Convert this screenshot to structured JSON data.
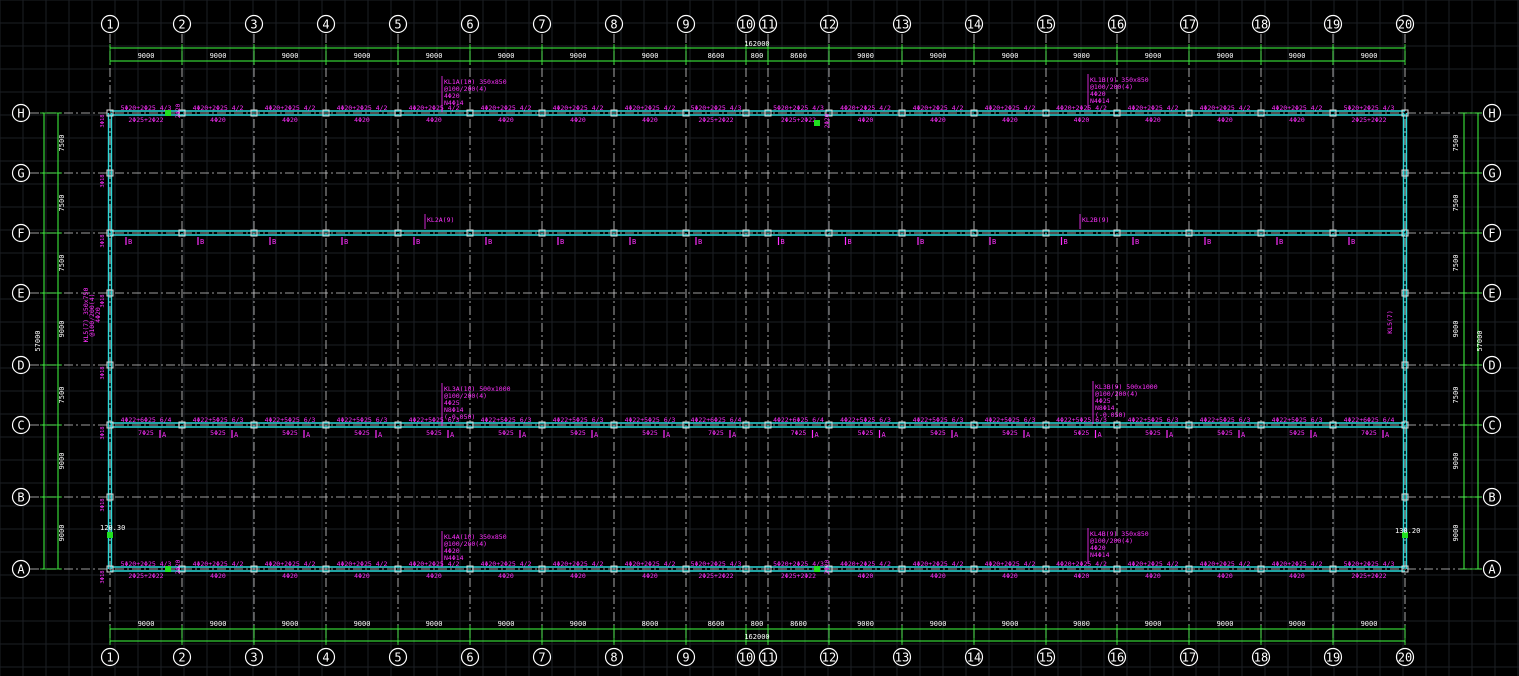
{
  "colors": {
    "background": "#000000",
    "grid": "#1c1f24",
    "axis_line": "#d0d0d0",
    "bubble": "#ffffff",
    "dimension": "#40ff40",
    "beam": "#2ad8d8",
    "annotation": "#ff30ff",
    "column": "#d8d8d8"
  },
  "column_axes": [
    {
      "label": "1"
    },
    {
      "label": "2"
    },
    {
      "label": "3"
    },
    {
      "label": "4"
    },
    {
      "label": "5"
    },
    {
      "label": "6"
    },
    {
      "label": "7"
    },
    {
      "label": "8"
    },
    {
      "label": "9"
    },
    {
      "label": "10"
    },
    {
      "label": "11"
    },
    {
      "label": "12"
    },
    {
      "label": "13"
    },
    {
      "label": "14"
    },
    {
      "label": "15"
    },
    {
      "label": "16"
    },
    {
      "label": "17"
    },
    {
      "label": "18"
    },
    {
      "label": "19"
    },
    {
      "label": "20"
    }
  ],
  "row_axes": [
    {
      "label": "H"
    },
    {
      "label": "G"
    },
    {
      "label": "F"
    },
    {
      "label": "E"
    },
    {
      "label": "D"
    },
    {
      "label": "C"
    },
    {
      "label": "B"
    },
    {
      "label": "A"
    }
  ],
  "dimensions": {
    "total_horizontal": "162000",
    "bays_horizontal": [
      "9000",
      "9000",
      "9000",
      "9000",
      "9000",
      "9000",
      "9000",
      "9000",
      "8600",
      "800",
      "8600",
      "9000",
      "9000",
      "9000",
      "9000",
      "9000",
      "9000",
      "9000",
      "9000"
    ],
    "bays_horizontal_bottom": [
      "9000",
      "9000",
      "9000",
      "9000",
      "9000",
      "9000",
      "9000",
      "8000",
      "8600",
      "800",
      "8600",
      "9000",
      "9000",
      "9000",
      "9000",
      "9000",
      "9000",
      "9000",
      "9000"
    ],
    "total_vertical": "57000",
    "bays_vertical": [
      "7500",
      "7500",
      "7500",
      "9000",
      "7500",
      "9000",
      "9000"
    ]
  },
  "beam_labels": {
    "top_left_callout": [
      "KL1A(10) 350x850",
      "@100/200(4)",
      "4Φ20",
      "N4Φ14"
    ],
    "top_right_callout": [
      "KL1B(9) 350x850",
      "@100/200(4)",
      "4Φ20",
      "N4Φ14"
    ],
    "f_left_callout": "KL2A(9)",
    "f_right_callout": "KL2B(9)",
    "c_left_callout": [
      "KL3A(10) 500x1000",
      "@100/200(4)",
      "4Φ25",
      "N8Φ14",
      "(-0.050)"
    ],
    "c_right_callout": [
      "KL3B(9) 500x1000",
      "@100/200(4)",
      "4Φ25",
      "N8Φ14",
      "(-0.050)"
    ],
    "a_left_callout": [
      "KL4A(10) 350x850",
      "@100/200(4)",
      "4Φ20",
      "N4Φ14"
    ],
    "a_right_callout": [
      "KL4B(9) 350x850",
      "@100/200(4)",
      "4Φ20",
      "N4Φ14"
    ],
    "h_top_span": [
      "5Φ20+2Φ25 4/3",
      "4Φ20+2Φ25 4/2",
      "4Φ20+2Φ25 4/2",
      "4Φ20+2Φ25 4/2",
      "4Φ20+2Φ25 4/2",
      "4Φ20+2Φ25 4/2",
      "4Φ20+2Φ25 4/2",
      "4Φ20+2Φ25 4/2",
      "5Φ20+2Φ25 4/3",
      "",
      "5Φ20+2Φ25 4/3",
      "4Φ20+2Φ25 4/2",
      "4Φ20+2Φ25 4/2",
      "4Φ20+2Φ25 4/2",
      "4Φ20+2Φ25 4/2",
      "4Φ20+2Φ25 4/2",
      "4Φ20+2Φ25 4/2",
      "4Φ20+2Φ25 4/2",
      "5Φ20+2Φ25 4/3"
    ],
    "h_bottom_span": [
      "2Φ25+2Φ22",
      "4Φ20",
      "4Φ20",
      "4Φ20",
      "4Φ20",
      "4Φ20",
      "4Φ20",
      "4Φ20",
      "2Φ25+2Φ22",
      "",
      "2Φ25+2Φ22",
      "4Φ20",
      "4Φ20",
      "4Φ20",
      "4Φ20",
      "4Φ20",
      "4Φ20",
      "4Φ20",
      "2Φ25+2Φ22"
    ],
    "c_top_span": [
      "4Φ22+6Φ25 6/4",
      "4Φ22+5Φ25 6/3",
      "4Φ22+5Φ25 6/3",
      "4Φ22+5Φ25 6/3",
      "4Φ22+5Φ25 6/3",
      "4Φ22+5Φ25 6/3",
      "4Φ22+5Φ25 6/3",
      "4Φ22+5Φ25 6/3",
      "4Φ22+6Φ25 6/4",
      "",
      "4Φ22+6Φ25 6/4",
      "4Φ22+5Φ25 6/3",
      "4Φ22+5Φ25 6/3",
      "4Φ22+5Φ25 6/3",
      "4Φ22+5Φ25 6/3",
      "4Φ22+5Φ25 6/3",
      "4Φ22+5Φ25 6/3",
      "4Φ22+5Φ25 6/3",
      "4Φ22+6Φ25 6/4"
    ],
    "c_bottom_span": [
      "7Φ25",
      "5Φ25",
      "5Φ25",
      "5Φ25",
      "5Φ25",
      "5Φ25",
      "5Φ25",
      "5Φ25",
      "7Φ25",
      "",
      "7Φ25",
      "5Φ25",
      "5Φ25",
      "5Φ25",
      "5Φ25",
      "5Φ25",
      "5Φ25",
      "5Φ25",
      "7Φ25"
    ],
    "a_top_span": [
      "5Φ20+2Φ25 4/3",
      "4Φ20+2Φ25 4/2",
      "4Φ20+2Φ25 4/2",
      "4Φ20+2Φ25 4/2",
      "4Φ20+2Φ25 4/2",
      "4Φ20+2Φ25 4/2",
      "4Φ20+2Φ25 4/2",
      "4Φ20+2Φ25 4/2",
      "5Φ20+2Φ25 4/3",
      "",
      "5Φ20+2Φ25 4/3",
      "4Φ20+2Φ25 4/2",
      "4Φ20+2Φ25 4/2",
      "4Φ20+2Φ25 4/2",
      "4Φ20+2Φ25 4/2",
      "4Φ20+2Φ25 4/2",
      "4Φ20+2Φ25 4/2",
      "4Φ20+2Φ25 4/2",
      "5Φ20+2Φ25 4/3"
    ],
    "a_bottom_span": [
      "2Φ25+2Φ22",
      "4Φ20",
      "4Φ20",
      "4Φ20",
      "4Φ20",
      "4Φ20",
      "4Φ20",
      "4Φ20",
      "2Φ25+2Φ22",
      "",
      "2Φ25+2Φ22",
      "4Φ20",
      "4Φ20",
      "4Φ20",
      "4Φ20",
      "4Φ20",
      "4Φ20",
      "4Φ20",
      "2Φ25+2Φ22"
    ],
    "section_mark_f": "B",
    "section_mark_c": "A",
    "left_edge_callout": [
      "KL5(7) 350x750",
      "@100/200(4)",
      "4Φ20"
    ],
    "right_edge_callout": "KL5(7)",
    "elevation_left_bottom": "120.30",
    "elevation_right_bottom": "130.20",
    "joint_top_left": "2Φ20",
    "joint_top_mid": "2Φ20",
    "joint_bottom_left": "2Φ20",
    "joint_bottom_mid": "2Φ20",
    "edge_tag": "3Φ18"
  }
}
